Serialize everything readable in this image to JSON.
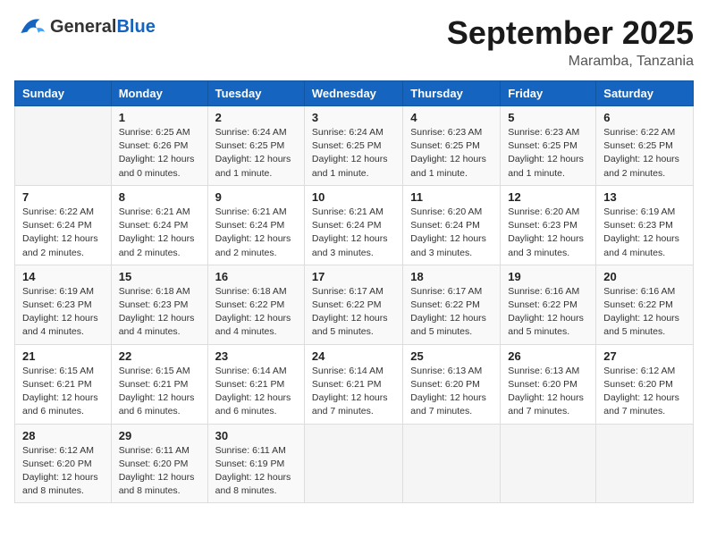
{
  "logo": {
    "general": "General",
    "blue": "Blue"
  },
  "title": "September 2025",
  "location": "Maramba, Tanzania",
  "days_of_week": [
    "Sunday",
    "Monday",
    "Tuesday",
    "Wednesday",
    "Thursday",
    "Friday",
    "Saturday"
  ],
  "weeks": [
    [
      {
        "num": "",
        "sunrise": "",
        "sunset": "",
        "daylight": ""
      },
      {
        "num": "1",
        "sunrise": "Sunrise: 6:25 AM",
        "sunset": "Sunset: 6:26 PM",
        "daylight": "Daylight: 12 hours and 0 minutes."
      },
      {
        "num": "2",
        "sunrise": "Sunrise: 6:24 AM",
        "sunset": "Sunset: 6:25 PM",
        "daylight": "Daylight: 12 hours and 1 minute."
      },
      {
        "num": "3",
        "sunrise": "Sunrise: 6:24 AM",
        "sunset": "Sunset: 6:25 PM",
        "daylight": "Daylight: 12 hours and 1 minute."
      },
      {
        "num": "4",
        "sunrise": "Sunrise: 6:23 AM",
        "sunset": "Sunset: 6:25 PM",
        "daylight": "Daylight: 12 hours and 1 minute."
      },
      {
        "num": "5",
        "sunrise": "Sunrise: 6:23 AM",
        "sunset": "Sunset: 6:25 PM",
        "daylight": "Daylight: 12 hours and 1 minute."
      },
      {
        "num": "6",
        "sunrise": "Sunrise: 6:22 AM",
        "sunset": "Sunset: 6:25 PM",
        "daylight": "Daylight: 12 hours and 2 minutes."
      }
    ],
    [
      {
        "num": "7",
        "sunrise": "Sunrise: 6:22 AM",
        "sunset": "Sunset: 6:24 PM",
        "daylight": "Daylight: 12 hours and 2 minutes."
      },
      {
        "num": "8",
        "sunrise": "Sunrise: 6:21 AM",
        "sunset": "Sunset: 6:24 PM",
        "daylight": "Daylight: 12 hours and 2 minutes."
      },
      {
        "num": "9",
        "sunrise": "Sunrise: 6:21 AM",
        "sunset": "Sunset: 6:24 PM",
        "daylight": "Daylight: 12 hours and 2 minutes."
      },
      {
        "num": "10",
        "sunrise": "Sunrise: 6:21 AM",
        "sunset": "Sunset: 6:24 PM",
        "daylight": "Daylight: 12 hours and 3 minutes."
      },
      {
        "num": "11",
        "sunrise": "Sunrise: 6:20 AM",
        "sunset": "Sunset: 6:24 PM",
        "daylight": "Daylight: 12 hours and 3 minutes."
      },
      {
        "num": "12",
        "sunrise": "Sunrise: 6:20 AM",
        "sunset": "Sunset: 6:23 PM",
        "daylight": "Daylight: 12 hours and 3 minutes."
      },
      {
        "num": "13",
        "sunrise": "Sunrise: 6:19 AM",
        "sunset": "Sunset: 6:23 PM",
        "daylight": "Daylight: 12 hours and 4 minutes."
      }
    ],
    [
      {
        "num": "14",
        "sunrise": "Sunrise: 6:19 AM",
        "sunset": "Sunset: 6:23 PM",
        "daylight": "Daylight: 12 hours and 4 minutes."
      },
      {
        "num": "15",
        "sunrise": "Sunrise: 6:18 AM",
        "sunset": "Sunset: 6:23 PM",
        "daylight": "Daylight: 12 hours and 4 minutes."
      },
      {
        "num": "16",
        "sunrise": "Sunrise: 6:18 AM",
        "sunset": "Sunset: 6:22 PM",
        "daylight": "Daylight: 12 hours and 4 minutes."
      },
      {
        "num": "17",
        "sunrise": "Sunrise: 6:17 AM",
        "sunset": "Sunset: 6:22 PM",
        "daylight": "Daylight: 12 hours and 5 minutes."
      },
      {
        "num": "18",
        "sunrise": "Sunrise: 6:17 AM",
        "sunset": "Sunset: 6:22 PM",
        "daylight": "Daylight: 12 hours and 5 minutes."
      },
      {
        "num": "19",
        "sunrise": "Sunrise: 6:16 AM",
        "sunset": "Sunset: 6:22 PM",
        "daylight": "Daylight: 12 hours and 5 minutes."
      },
      {
        "num": "20",
        "sunrise": "Sunrise: 6:16 AM",
        "sunset": "Sunset: 6:22 PM",
        "daylight": "Daylight: 12 hours and 5 minutes."
      }
    ],
    [
      {
        "num": "21",
        "sunrise": "Sunrise: 6:15 AM",
        "sunset": "Sunset: 6:21 PM",
        "daylight": "Daylight: 12 hours and 6 minutes."
      },
      {
        "num": "22",
        "sunrise": "Sunrise: 6:15 AM",
        "sunset": "Sunset: 6:21 PM",
        "daylight": "Daylight: 12 hours and 6 minutes."
      },
      {
        "num": "23",
        "sunrise": "Sunrise: 6:14 AM",
        "sunset": "Sunset: 6:21 PM",
        "daylight": "Daylight: 12 hours and 6 minutes."
      },
      {
        "num": "24",
        "sunrise": "Sunrise: 6:14 AM",
        "sunset": "Sunset: 6:21 PM",
        "daylight": "Daylight: 12 hours and 7 minutes."
      },
      {
        "num": "25",
        "sunrise": "Sunrise: 6:13 AM",
        "sunset": "Sunset: 6:20 PM",
        "daylight": "Daylight: 12 hours and 7 minutes."
      },
      {
        "num": "26",
        "sunrise": "Sunrise: 6:13 AM",
        "sunset": "Sunset: 6:20 PM",
        "daylight": "Daylight: 12 hours and 7 minutes."
      },
      {
        "num": "27",
        "sunrise": "Sunrise: 6:12 AM",
        "sunset": "Sunset: 6:20 PM",
        "daylight": "Daylight: 12 hours and 7 minutes."
      }
    ],
    [
      {
        "num": "28",
        "sunrise": "Sunrise: 6:12 AM",
        "sunset": "Sunset: 6:20 PM",
        "daylight": "Daylight: 12 hours and 8 minutes."
      },
      {
        "num": "29",
        "sunrise": "Sunrise: 6:11 AM",
        "sunset": "Sunset: 6:20 PM",
        "daylight": "Daylight: 12 hours and 8 minutes."
      },
      {
        "num": "30",
        "sunrise": "Sunrise: 6:11 AM",
        "sunset": "Sunset: 6:19 PM",
        "daylight": "Daylight: 12 hours and 8 minutes."
      },
      {
        "num": "",
        "sunrise": "",
        "sunset": "",
        "daylight": ""
      },
      {
        "num": "",
        "sunrise": "",
        "sunset": "",
        "daylight": ""
      },
      {
        "num": "",
        "sunrise": "",
        "sunset": "",
        "daylight": ""
      },
      {
        "num": "",
        "sunrise": "",
        "sunset": "",
        "daylight": ""
      }
    ]
  ]
}
